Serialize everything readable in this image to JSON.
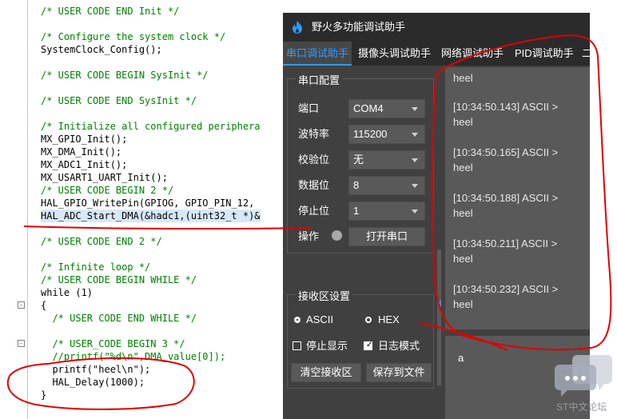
{
  "editor": {
    "lines": [
      "/* USER CODE END Init */",
      "",
      "/* Configure the system clock */",
      "SystemClock_Config();",
      "",
      "/* USER CODE BEGIN SysInit */",
      "",
      "/* USER CODE END SysInit */",
      "",
      "/* Initialize all configured periphera",
      "MX_GPIO_Init();",
      "MX_DMA_Init();",
      "MX_ADC1_Init();",
      "MX_USART1_UART_Init();",
      "/* USER CODE BEGIN 2 */",
      "HAL_GPIO_WritePin(GPIOG, GPIO_PIN_12,",
      "HAL_ADC_Start_DMA(&hadc1,(uint32_t *)&",
      "",
      "/* USER CODE END 2 */",
      "",
      "/* Infinite loop */",
      "/* USER CODE BEGIN WHILE */",
      "while (1)",
      "{",
      "  /* USER CODE END WHILE */",
      "",
      "  /* USER_CODE BEGIN 3 */",
      "  //printf(\"%d\\n\",DMA_value[0]);",
      "  printf(\"heel\\n\");",
      "  HAL_Delay(1000);",
      "}"
    ],
    "fold_markers": [
      "-",
      "-"
    ]
  },
  "app": {
    "title": "野火多功能调试助手",
    "tabs": [
      "串口调试助手",
      "摄像头调试助手",
      "网络调试助手",
      "PID调试助手",
      "二"
    ],
    "serial_config": {
      "group_title": "串口配置",
      "port_label": "端口",
      "port_value": "COM4",
      "baud_label": "波特率",
      "baud_value": "115200",
      "parity_label": "校验位",
      "parity_value": "无",
      "databits_label": "数据位",
      "databits_value": "8",
      "stopbits_label": "停止位",
      "stopbits_value": "1",
      "operate_label": "操作",
      "open_button": "打开串口"
    },
    "recv_settings": {
      "group_title": "接收区设置",
      "ascii_label": "ASCII",
      "ascii_selected": true,
      "hex_label": "HEX",
      "hex_selected": false,
      "stop_display_label": "停止显示",
      "stop_display_checked": false,
      "log_mode_label": "日志模式",
      "log_mode_checked": true,
      "clear_button": "清空接收区",
      "save_button": "保存到文件"
    },
    "recv_partial": "heel",
    "messages": [
      {
        "header": "[10:34:50.143] ASCII >",
        "text": "heel"
      },
      {
        "header": "[10:34:50.165] ASCII >",
        "text": "heel"
      },
      {
        "header": "[10:34:50.188] ASCII >",
        "text": "heel"
      },
      {
        "header": "[10:34:50.211] ASCII >",
        "text": "heel"
      },
      {
        "header": "[10:34:50.232] ASCII >",
        "text": "heel"
      }
    ],
    "send_text": "a"
  },
  "watermark": {
    "text": "ST中文论坛",
    "icon": "chat-bubbles-icon"
  },
  "colors": {
    "annotation": "#e00000",
    "accent": "#2f9bff",
    "comment": "#008000",
    "keyword": "#0000ff"
  }
}
